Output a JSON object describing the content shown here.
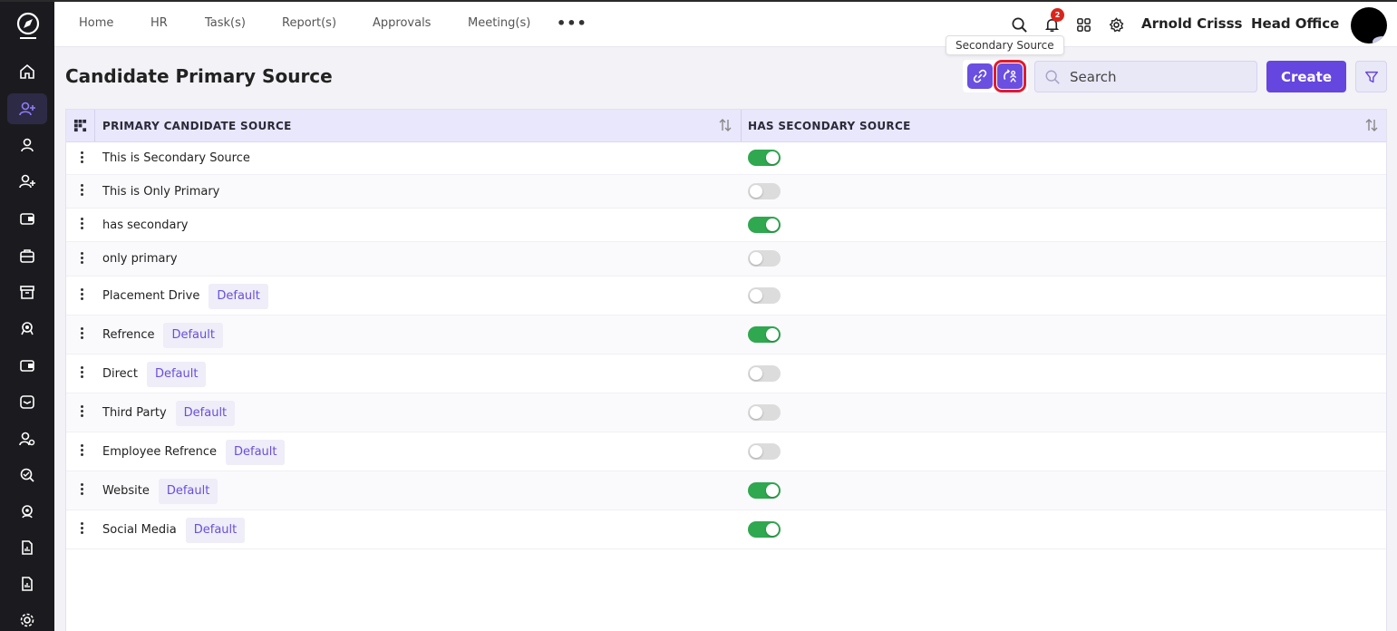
{
  "topbar": {
    "nav": [
      "Home",
      "HR",
      "Task(s)",
      "Report(s)",
      "Approvals",
      "Meeting(s)"
    ],
    "more_label": "•••",
    "notification_count": "2",
    "user_name": "Arnold Crisss",
    "office": "Head Office"
  },
  "tooltip": "Secondary Source",
  "page": {
    "title": "Candidate Primary Source",
    "search_placeholder": "Search",
    "create_label": "Create"
  },
  "table": {
    "headers": [
      "PRIMARY CANDIDATE SOURCE",
      "HAS SECONDARY SOURCE"
    ],
    "default_tag": "Default",
    "rows": [
      {
        "label": "This is Secondary Source",
        "is_default": false,
        "has_secondary": true
      },
      {
        "label": "This is Only Primary",
        "is_default": false,
        "has_secondary": false
      },
      {
        "label": "has secondary",
        "is_default": false,
        "has_secondary": true
      },
      {
        "label": "only primary",
        "is_default": false,
        "has_secondary": false
      },
      {
        "label": "Placement Drive",
        "is_default": true,
        "has_secondary": false
      },
      {
        "label": "Refrence",
        "is_default": true,
        "has_secondary": true
      },
      {
        "label": "Direct",
        "is_default": true,
        "has_secondary": false
      },
      {
        "label": "Third Party",
        "is_default": true,
        "has_secondary": false
      },
      {
        "label": "Employee Refrence",
        "is_default": true,
        "has_secondary": false
      },
      {
        "label": "Website",
        "is_default": true,
        "has_secondary": true
      },
      {
        "label": "Social Media",
        "is_default": true,
        "has_secondary": true
      }
    ]
  },
  "colors": {
    "accent": "#6546de",
    "toggle_on": "#2fa84f",
    "sidebar_bg": "#1b1b1f",
    "highlight": "#e01b2e"
  }
}
